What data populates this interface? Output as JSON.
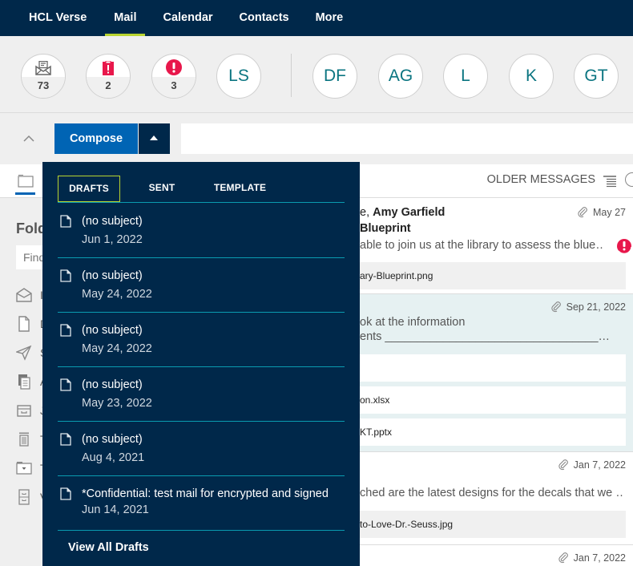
{
  "topnav": {
    "items": [
      {
        "label": "HCL Verse",
        "active": false
      },
      {
        "label": "Mail",
        "active": true
      },
      {
        "label": "Calendar",
        "active": false
      },
      {
        "label": "Contacts",
        "active": false
      },
      {
        "label": "More",
        "active": false
      }
    ]
  },
  "badges": {
    "counters": [
      {
        "icon": "open-envelope-icon",
        "count": "73"
      },
      {
        "icon": "clipboard-alert-icon",
        "count": "2"
      },
      {
        "icon": "exclamation-circle-icon",
        "count": "3"
      }
    ],
    "people": [
      "LS",
      "DF",
      "AG",
      "L",
      "K",
      "GT"
    ]
  },
  "toolbar": {
    "compose_label": "Compose",
    "search_placeholder": ""
  },
  "folders": {
    "title": "Folders",
    "find_placeholder": "Find",
    "items": [
      {
        "icon": "inbox-icon",
        "label": "Inbox"
      },
      {
        "icon": "draft-icon",
        "label": "Drafts"
      },
      {
        "icon": "send-icon",
        "label": "Sent"
      },
      {
        "icon": "all-documents-icon",
        "label": "All Documents"
      },
      {
        "icon": "junk-icon",
        "label": "Junk"
      },
      {
        "icon": "trash-icon",
        "label": "Trash"
      },
      {
        "icon": "folder-icon",
        "label": "T"
      },
      {
        "icon": "archive-icon",
        "label": "V"
      }
    ]
  },
  "main": {
    "older_messages_label": "OLDER MESSAGES",
    "messages": [
      {
        "sender_prefix": "e, ",
        "sender": "Amy Garfield",
        "subject": "Blueprint",
        "snippet": "able to join us at the library to assess the blue…",
        "date": "May 27",
        "has_attachment": true,
        "important": true,
        "attachments": [
          "ary-Blueprint.png"
        ]
      },
      {
        "snippet_line1": "ok at the information",
        "snippet_line2": "ents _________________________________…",
        "date": "Sep 21, 2022",
        "has_attachment": true,
        "attachments": [
          "",
          "on.xlsx",
          "KT.pptx"
        ]
      },
      {
        "snippet": "ched are the latest designs for the decals that we …",
        "date": "Jan 7, 2022",
        "has_attachment": true,
        "attachments": [
          "to-Love-Dr.-Seuss.jpg"
        ]
      },
      {
        "date": "Jan 7, 2022",
        "has_attachment": true
      }
    ]
  },
  "dropdown": {
    "tabs": [
      {
        "label": "DRAFTS",
        "active": true
      },
      {
        "label": "SENT",
        "active": false
      },
      {
        "label": "TEMPLATE",
        "active": false
      }
    ],
    "drafts": [
      {
        "subject": "(no subject)",
        "date": "Jun 1, 2022"
      },
      {
        "subject": "(no subject)",
        "date": "May 24, 2022"
      },
      {
        "subject": "(no subject)",
        "date": "May 24, 2022"
      },
      {
        "subject": "(no subject)",
        "date": "May 23, 2022"
      },
      {
        "subject": "(no subject)",
        "date": "Aug 4, 2021"
      },
      {
        "subject": "*Confidential: test mail for encrypted and signed",
        "date": "Jun 14, 2021"
      }
    ],
    "view_all_label": "View All Drafts"
  },
  "colors": {
    "nav_bg": "#00284a",
    "accent_green": "#b8d430",
    "compose_blue": "#0064b4",
    "teal_initials": "#0b7581",
    "separator_teal": "#0a9bb0",
    "alert_red": "#e8174b"
  }
}
